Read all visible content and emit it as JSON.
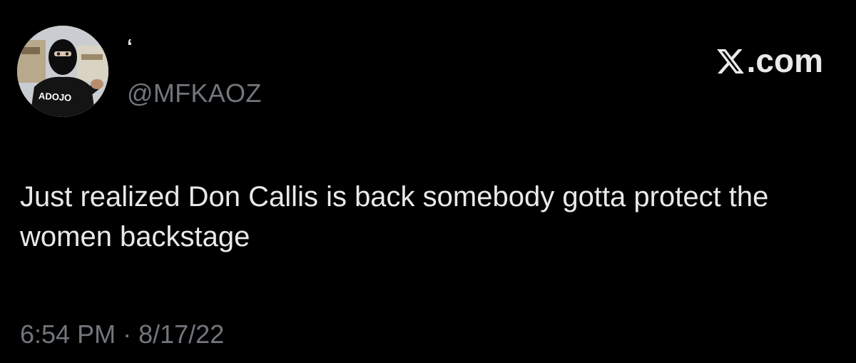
{
  "author": {
    "display_name": "‘",
    "handle": "@MFKAOZ",
    "avatar_shirt_text": "ADOJO"
  },
  "brand": {
    "text": ".com",
    "icon": "x-logo-icon"
  },
  "tweet": {
    "text": "Just realized Don Callis is back somebody gotta protect the women backstage",
    "time": "6:54 PM",
    "separator": "·",
    "date": "8/17/22"
  },
  "colors": {
    "background": "#000000",
    "primary_text": "#e7e9ea",
    "secondary_text": "#71767b"
  }
}
